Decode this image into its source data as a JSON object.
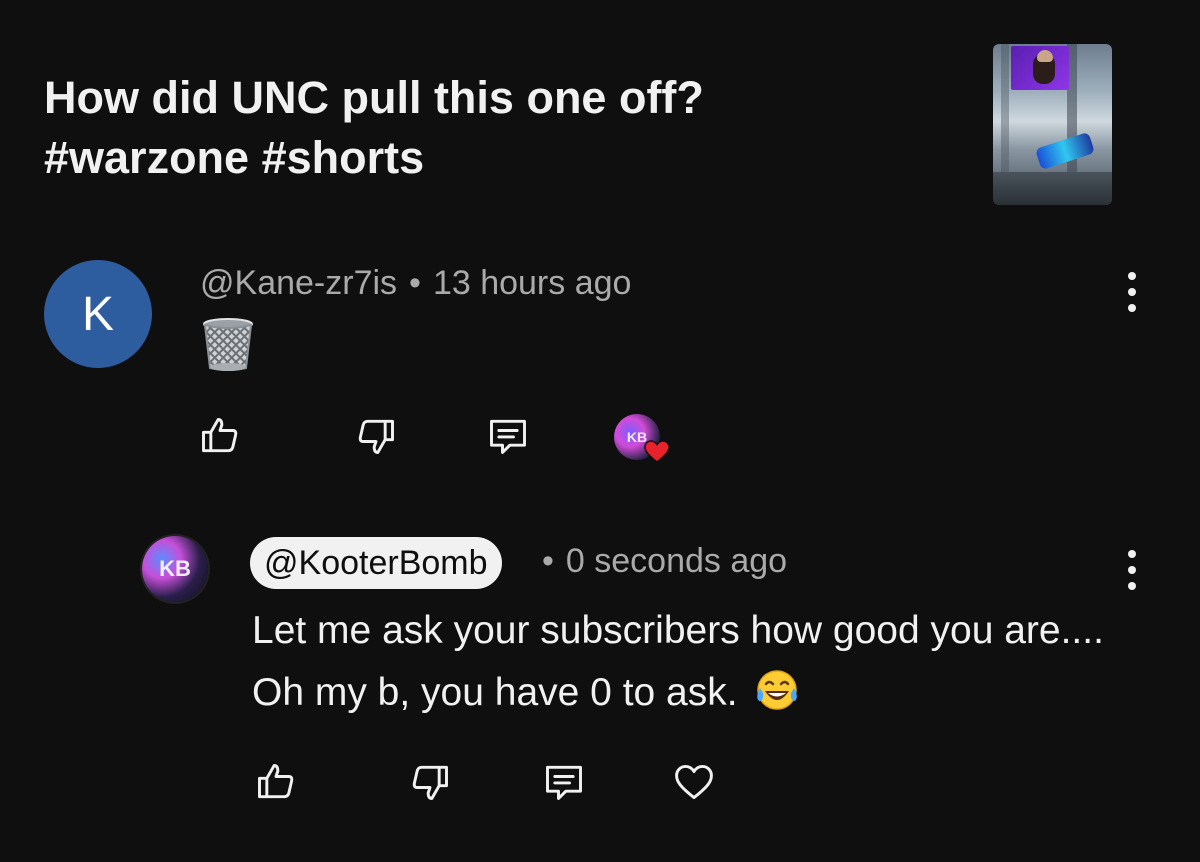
{
  "video": {
    "title": "How did UNC pull this one off? #warzone #shorts"
  },
  "comment": {
    "avatar_letter": "K",
    "author": "@Kane-zr7is",
    "separator": "•",
    "time": "13 hours ago",
    "body_icon": "wastebasket-emoji"
  },
  "reply": {
    "author": "@KooterBomb",
    "separator": "•",
    "time": "0 seconds ago",
    "body": "Let me ask your subscribers how good you are.... Oh my b, you have 0 to ask.",
    "emoji": "face-with-tears-of-joy",
    "avatar_initials": "KB"
  },
  "icons": {
    "like": "thumbs-up-icon",
    "dislike": "thumbs-down-icon",
    "reply": "comment-icon",
    "heart": "heart-icon",
    "more": "more-vertical-icon"
  },
  "colors": {
    "background": "#0f0f0f",
    "text": "#f1f1f1",
    "meta": "#aaaaaa",
    "avatar_k": "#2e5d9f",
    "heart_badge": "#e8222a"
  }
}
